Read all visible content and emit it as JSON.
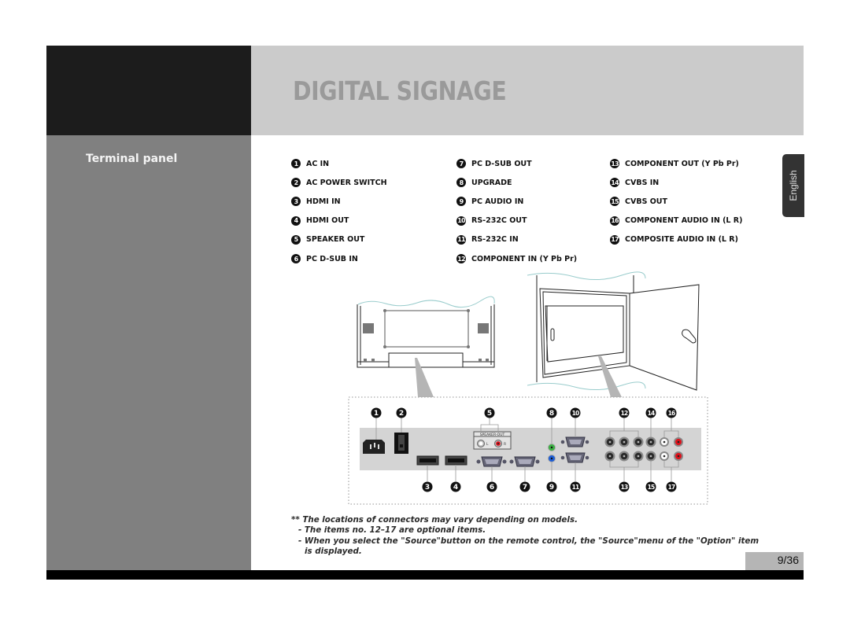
{
  "header": {
    "title": "DIGITAL SIGNAGE"
  },
  "sidebar": {
    "section_title": "Terminal panel"
  },
  "language_tab": "English",
  "legend": {
    "columns": [
      [
        {
          "num": "1",
          "label": "AC IN"
        },
        {
          "num": "2",
          "label": "AC POWER SWITCH"
        },
        {
          "num": "3",
          "label": "HDMI IN"
        },
        {
          "num": "4",
          "label": "HDMI OUT"
        },
        {
          "num": "5",
          "label": "SPEAKER OUT"
        },
        {
          "num": "6",
          "label": "PC D-SUB IN"
        }
      ],
      [
        {
          "num": "7",
          "label": "PC D-SUB OUT"
        },
        {
          "num": "8",
          "label": "UPGRADE"
        },
        {
          "num": "9",
          "label": "PC AUDIO IN"
        },
        {
          "num": "10",
          "label": "RS-232C OUT"
        },
        {
          "num": "11",
          "label": "RS-232C IN"
        },
        {
          "num": "12",
          "label": "COMPONENT IN (Y Pb Pr)"
        }
      ],
      [
        {
          "num": "13",
          "label": "COMPONENT OUT (Y Pb Pr)"
        },
        {
          "num": "14",
          "label": "CVBS IN"
        },
        {
          "num": "15",
          "label": "CVBS OUT"
        },
        {
          "num": "16",
          "label": "COMPONENT AUDIO IN (L R)"
        },
        {
          "num": "17",
          "label": "COMPOSITE AUDIO IN (L R)"
        }
      ]
    ]
  },
  "diagram": {
    "speaker_out_label": "SPEAKER-OUT",
    "speaker_left": "L",
    "speaker_right": "R",
    "callouts_top": [
      "1",
      "2",
      "5",
      "8",
      "10",
      "12",
      "14",
      "16"
    ],
    "callouts_bottom": [
      "3",
      "4",
      "6",
      "7",
      "9",
      "11",
      "13",
      "15",
      "17"
    ],
    "colors": {
      "upgrade_port": "#3cb043",
      "pc_audio_port": "#1f5fd6",
      "red_jack": "#e0101a",
      "white_jack": "#ffffff",
      "panel_fill": "#d4d4d4",
      "arrow_fill": "#b5b5b5"
    }
  },
  "notes": {
    "line1": "** The locations of connectors may vary depending on models.",
    "line2": "- The items no. 12–17 are optional items.",
    "line3": "- When you select the \"Source\"button on the remote control, the \"Source\"menu of the \"Option\" item",
    "line4": "is displayed."
  },
  "page_number": "9/36"
}
